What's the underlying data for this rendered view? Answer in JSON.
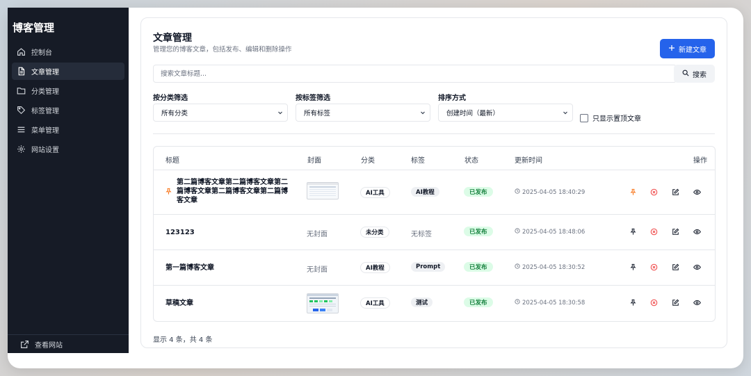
{
  "sidebar": {
    "brand": "博客管理",
    "items": [
      {
        "label": "控制台",
        "icon": "home-icon"
      },
      {
        "label": "文章管理",
        "icon": "document-icon",
        "active": true
      },
      {
        "label": "分类管理",
        "icon": "folder-icon"
      },
      {
        "label": "标签管理",
        "icon": "tag-icon"
      },
      {
        "label": "菜单管理",
        "icon": "menu-icon"
      },
      {
        "label": "网站设置",
        "icon": "gear-icon"
      }
    ],
    "footer_link": "查看网站"
  },
  "header": {
    "title": "文章管理",
    "subtitle": "管理您的博客文章，包括发布、编辑和删除操作",
    "new_button": "新建文章"
  },
  "search": {
    "placeholder": "搜索文章标题...",
    "button": "搜索"
  },
  "filters": {
    "category_label": "按分类筛选",
    "category_value": "所有分类",
    "tag_label": "按标签筛选",
    "tag_value": "所有标签",
    "sort_label": "排序方式",
    "sort_value": "创建时间（最新）",
    "pinned_only_label": "只显示置顶文章",
    "pinned_only_checked": false
  },
  "table": {
    "columns": [
      "标题",
      "封面",
      "分类",
      "标签",
      "状态",
      "更新时间",
      "操作"
    ],
    "rows": [
      {
        "title": "第二篇博客文章第二篇博客文章第二篇博客文章第二篇博客文章第二篇博客文章",
        "cover": "image",
        "category": "AI工具",
        "tag": "AI教程",
        "tag_style": "chip",
        "status": "已发布",
        "updated": "2025-04-05 18:40:29",
        "pinned": true
      },
      {
        "title": "123123",
        "cover": "无封面",
        "category": "未分类",
        "tag": "无标签",
        "tag_style": "text",
        "status": "已发布",
        "updated": "2025-04-05 18:48:06",
        "pinned": false
      },
      {
        "title": "第一篇博客文章",
        "cover": "无封面",
        "category": "AI教程",
        "tag": "Prompt",
        "tag_style": "chip",
        "status": "已发布",
        "updated": "2025-04-05 18:30:52",
        "pinned": false
      },
      {
        "title": "草稿文章",
        "cover": "image",
        "category": "AI工具",
        "tag": "测试",
        "tag_style": "chip",
        "status": "已发布",
        "updated": "2025-04-05 18:30:58",
        "pinned": false
      }
    ]
  },
  "footer": {
    "summary": "显示 4 条，共 4 条"
  },
  "colors": {
    "sidebar_bg": "#161b26",
    "accent": "#2563eb",
    "status_green": "#15803d",
    "pin_active": "#f97316",
    "delete_red": "#ef4444"
  }
}
